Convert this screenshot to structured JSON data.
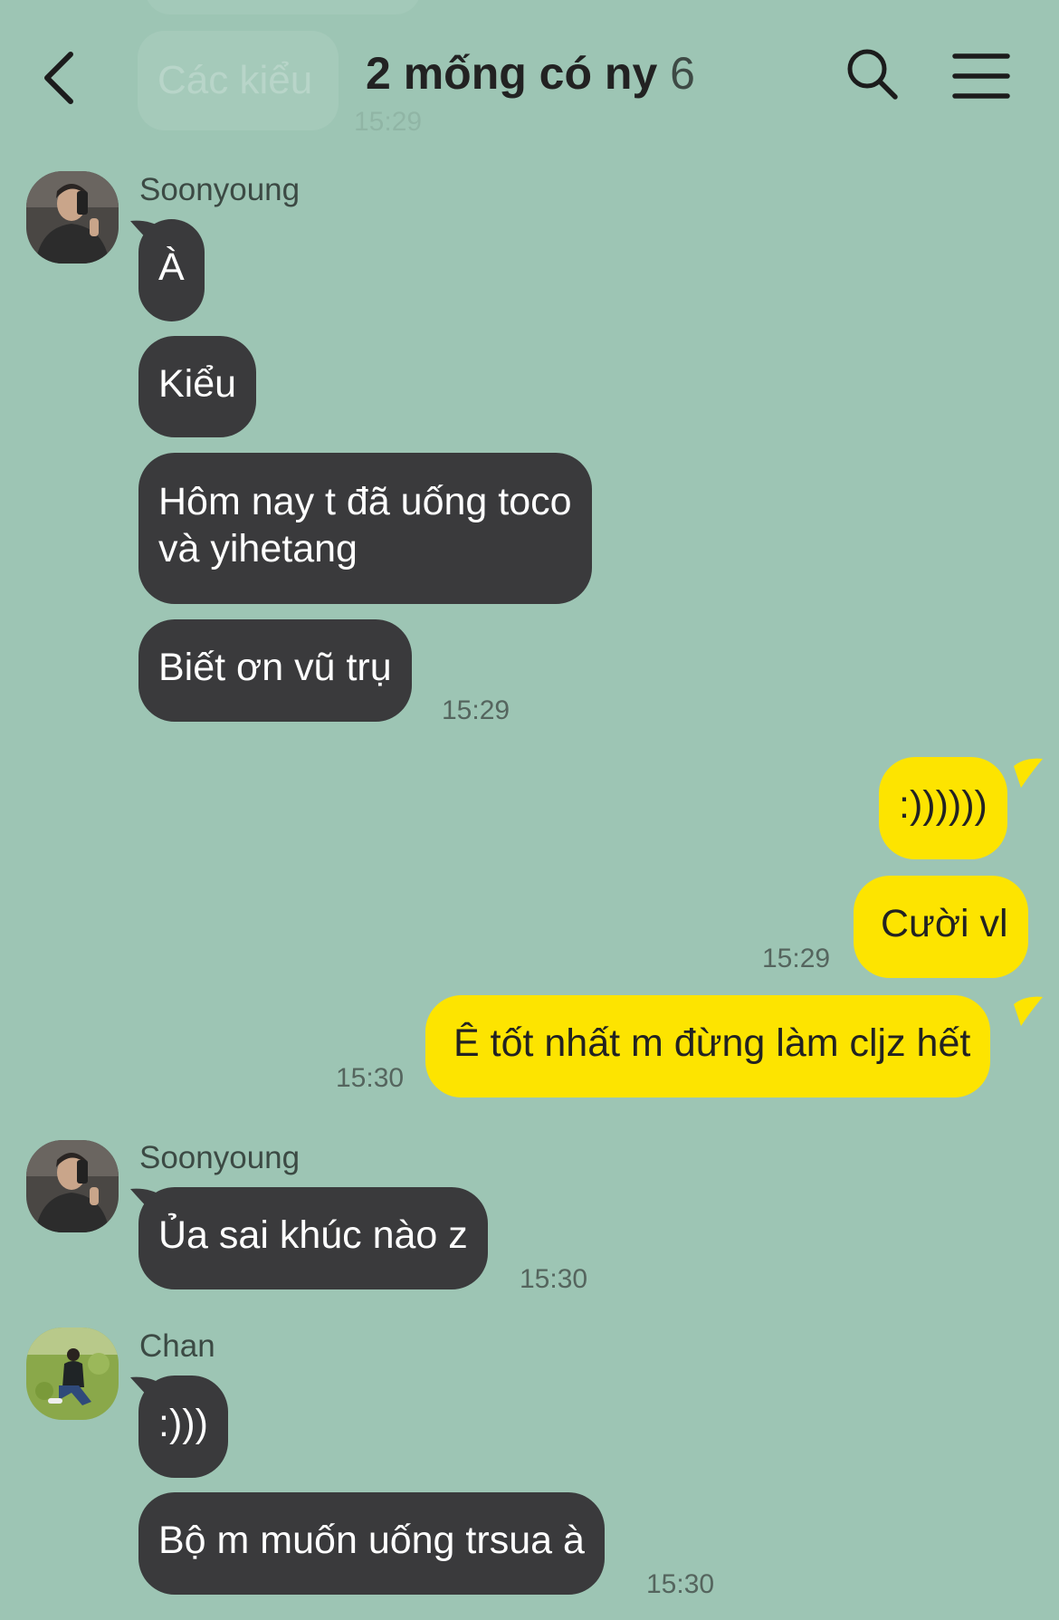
{
  "header": {
    "title": "2 mống có ny",
    "member_count": "6",
    "back_icon": "chevron-left-icon",
    "search_icon": "search-icon",
    "menu_icon": "hamburger-menu-icon"
  },
  "background_color": "#9dc5b4",
  "bubble_colors": {
    "received": "#3a3a3c",
    "sent": "#fde400"
  },
  "scrolled_preview": {
    "text": "Các kiểu",
    "time": "15:29"
  },
  "messages": [
    {
      "sender": "Soonyoung",
      "text": "À"
    },
    {
      "text": "Kiểu"
    },
    {
      "line1": "Hôm nay t đã uống toco",
      "line2": "và yihetang"
    },
    {
      "text": "Biết ơn vũ trụ",
      "time": "15:29"
    },
    {
      "text": ":))))))"
    },
    {
      "text": "Cười vl",
      "time": "15:29"
    },
    {
      "text": "Ê tốt nhất m đừng làm cljz hết",
      "time": "15:30"
    },
    {
      "sender": "Soonyoung",
      "text": "Ủa sai khúc nào z",
      "time": "15:30"
    },
    {
      "sender": "Chan",
      "text": ":)))"
    },
    {
      "text": "Bộ m muốn uống trsua à",
      "time": "15:30"
    }
  ]
}
